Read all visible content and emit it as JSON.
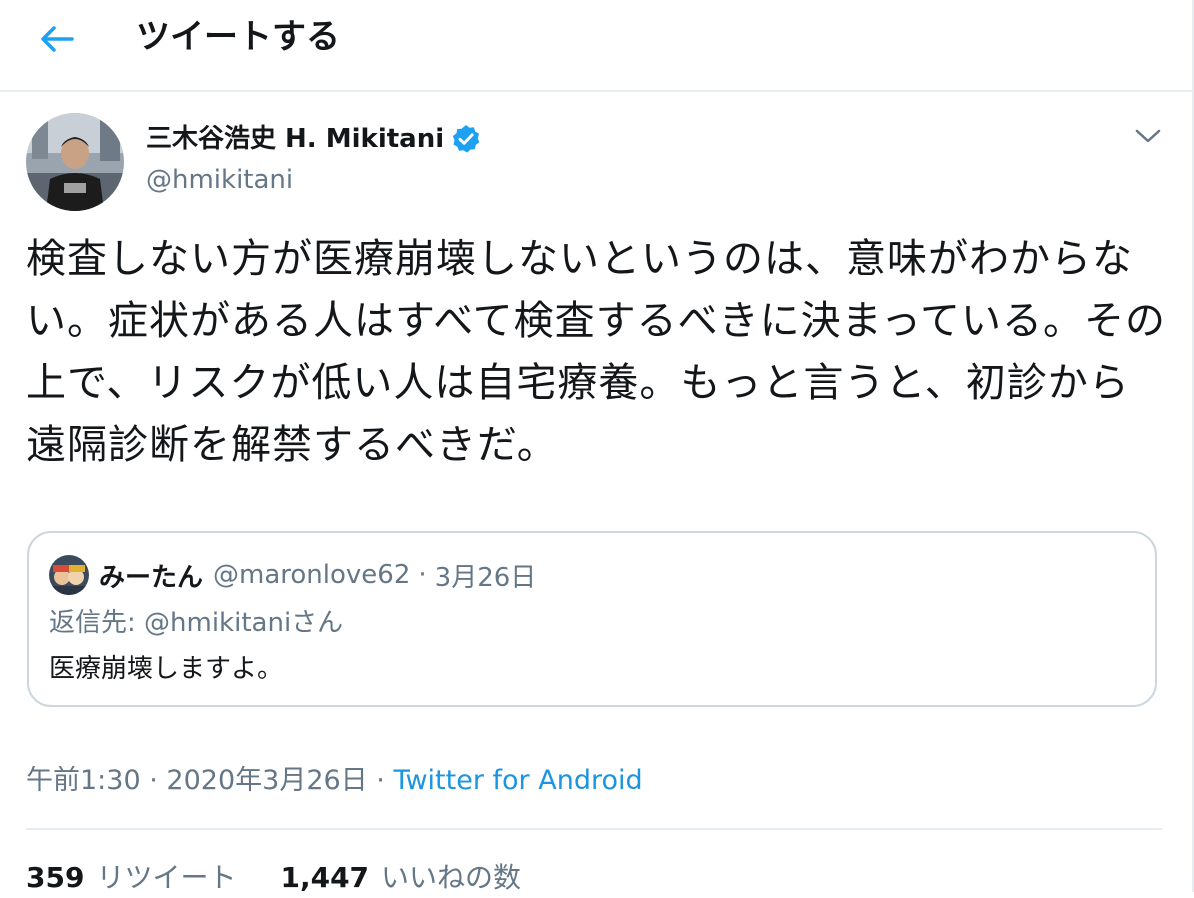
{
  "header": {
    "back_icon": "arrow-left-icon",
    "title": "ツイートする"
  },
  "colors": {
    "accent": "#1da1f2",
    "link": "#1b95e0",
    "secondary_text": "#657786",
    "primary_text": "#14171a",
    "border": "#ccd6dd"
  },
  "tweet": {
    "author_name": "三木谷浩史 H. Mikitani",
    "verified_icon": "verified-badge-icon",
    "handle": "@hmikitani",
    "caret_icon": "chevron-down-icon",
    "text": "検査しない方が医療崩壊しないというのは、意味がわからない。症状がある人はすべて検査するべきに決まっている。その上で、リスクが低い人は自宅療養。もっと言うと、初診から遠隔診断を解禁するべきだ。",
    "quoted": {
      "name": "みーたん",
      "handle": "@maronlove62",
      "separator": "·",
      "date": "3月26日",
      "reply_to": "返信先: @hmikitaniさん",
      "text": "医療崩壊しますよ。"
    },
    "time": "午前1:30",
    "separator": "·",
    "date": "2020年3月26日",
    "source": "Twitter for Android"
  },
  "stats": {
    "retweets_count": "359",
    "retweets_label": "リツイート",
    "likes_count": "1,447",
    "likes_label": "いいねの数"
  }
}
